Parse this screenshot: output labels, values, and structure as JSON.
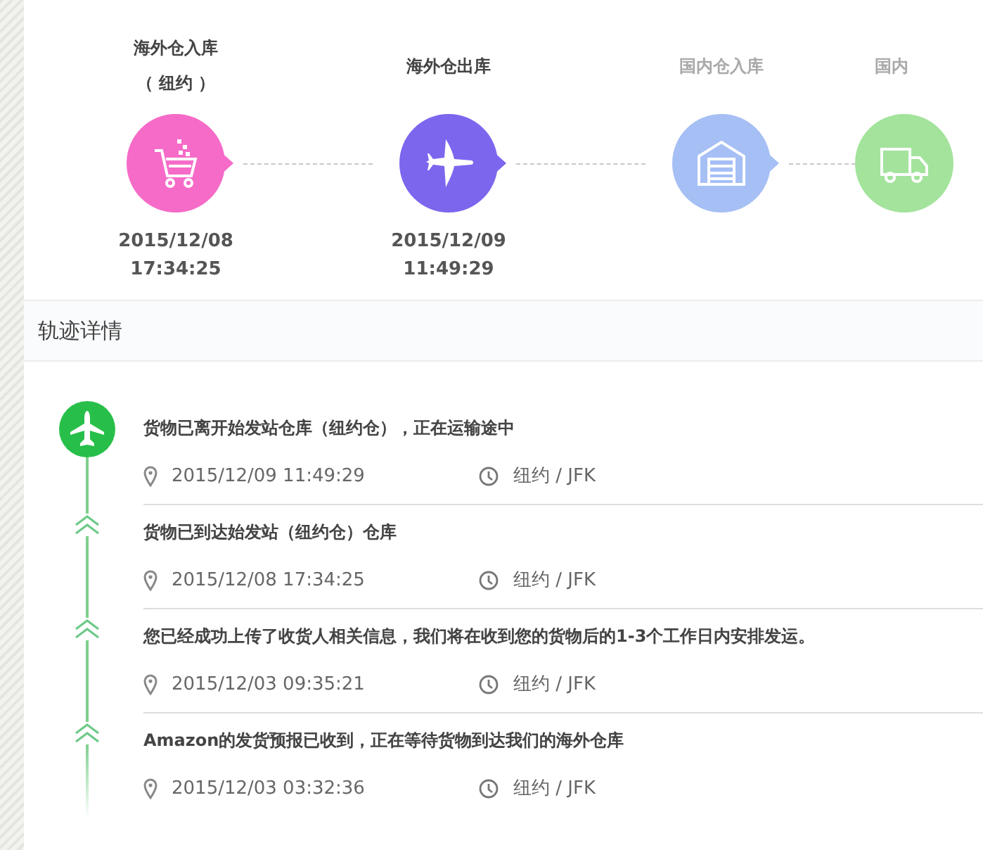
{
  "steps": [
    {
      "title": "海外仓入库",
      "subtitle": "（ 纽约 ）",
      "kind": "cart",
      "color": "#f56bc7",
      "done": true,
      "date": "2015/12/08",
      "time": "17:34:25"
    },
    {
      "title": "海外仓出库",
      "kind": "plane",
      "color": "#7c66ee",
      "done": true,
      "date": "2015/12/09",
      "time": "11:49:29"
    },
    {
      "title": "国内仓入库",
      "kind": "warehouse",
      "color": "#a6bff5",
      "done": false
    },
    {
      "title": "国内",
      "kind": "truck",
      "color": "#a3e39c",
      "done": false
    }
  ],
  "details_title": "轨迹详情",
  "events": [
    {
      "kind": "current",
      "text": "货物已离开始发站仓库（纽约仓），正在运输途中",
      "time": "2015/12/09 11:49:29",
      "place": "纽约 / JFK"
    },
    {
      "kind": "past",
      "text": "货物已到达始发站（纽约仓）仓库",
      "time": "2015/12/08 17:34:25",
      "place": "纽约 / JFK"
    },
    {
      "kind": "past",
      "text": "您已经成功上传了收货人相关信息，我们将在收到您的货物后的1-3个工作日内安排发运。",
      "time": "2015/12/03 09:35:21",
      "place": "纽约 / JFK"
    },
    {
      "kind": "past",
      "text": "Amazon的发货预报已收到，正在等待货物到达我们的海外仓库",
      "time": "2015/12/03 03:32:36",
      "place": "纽约 / JFK"
    }
  ]
}
